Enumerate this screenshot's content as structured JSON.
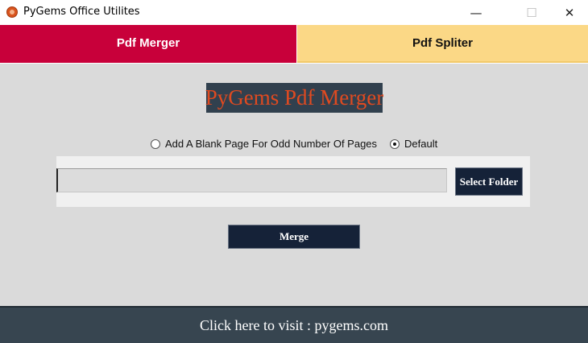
{
  "window": {
    "title": "PyGems Office Utilites",
    "icon": "pygems-logo-icon",
    "minimize_glyph": "—",
    "maximize_glyph": "☐",
    "close_glyph": "✕"
  },
  "tabs": [
    {
      "label": "Pdf Merger",
      "active": true,
      "color": "#c8003a"
    },
    {
      "label": "Pdf Spliter",
      "active": false,
      "color": "#fbd886"
    }
  ],
  "main": {
    "heading": "PyGems Pdf Merger",
    "options": [
      {
        "label": "Add A Blank Page For Odd Number Of Pages",
        "selected": false
      },
      {
        "label": "Default",
        "selected": true
      }
    ],
    "folder_path": {
      "value": "",
      "placeholder": ""
    },
    "select_folder_label": "Select Folder",
    "merge_label": "Merge"
  },
  "footer": {
    "link_text": "Click here to visit : pygems.com"
  },
  "colors": {
    "background": "#dadada",
    "button_bg": "#152238",
    "heading_bg": "#31404e",
    "heading_text": "#e04a20",
    "footer_bg": "#374550"
  }
}
